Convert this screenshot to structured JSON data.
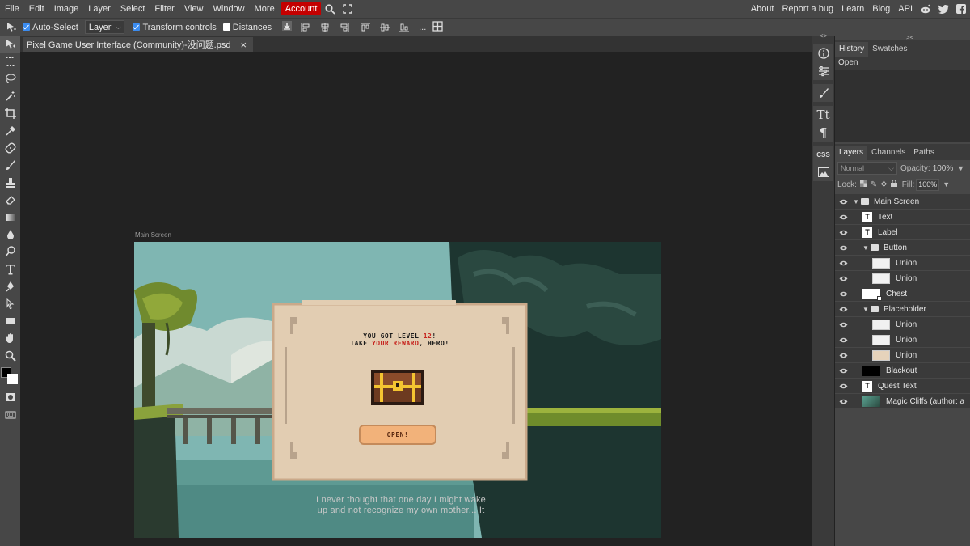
{
  "menu": {
    "items": [
      "File",
      "Edit",
      "Image",
      "Layer",
      "Select",
      "Filter",
      "View",
      "Window",
      "More"
    ],
    "account": "Account",
    "right_items": [
      "About",
      "Report a bug",
      "Learn",
      "Blog",
      "API"
    ]
  },
  "options": {
    "auto_select": "Auto-Select",
    "auto_select_checked": true,
    "target": "Layer",
    "transform_controls": "Transform controls",
    "transform_checked": true,
    "distances": "Distances",
    "distances_checked": false,
    "more": "..."
  },
  "document": {
    "tab_title": "Pixel Game User Interface (Community)-没问题.psd",
    "artboard_label": "Main Screen"
  },
  "artwork": {
    "dialog_line1_a": "YOU GOT LEVEL ",
    "dialog_line1_num": "12",
    "dialog_line1_b": "!",
    "dialog_line2_a": "TAKE ",
    "dialog_line2_red": "YOUR REWARD",
    "dialog_line2_b": ", HERO!",
    "button_label": "OPEN!",
    "quest_text_line1": "I never thought that one day I might wake",
    "quest_text_line2": "up and not recognize my own mother... It"
  },
  "right_panel": {
    "top_tabs": [
      "History",
      "Swatches"
    ],
    "history_items": [
      "Open"
    ],
    "layer_tabs": [
      "Layers",
      "Channels",
      "Paths"
    ],
    "blend_mode": "Normal",
    "opacity_label": "Opacity:",
    "opacity_value": "100%",
    "lock_label": "Lock:",
    "fill_label": "Fill:",
    "fill_value": "100%"
  },
  "layers": [
    {
      "name": "Main Screen",
      "kind": "folder",
      "indent": 0
    },
    {
      "name": "Text",
      "kind": "text",
      "indent": 1
    },
    {
      "name": "Label",
      "kind": "text",
      "indent": 1
    },
    {
      "name": "Button",
      "kind": "folder",
      "indent": 1
    },
    {
      "name": "Union",
      "kind": "shape",
      "indent": 2
    },
    {
      "name": "Union",
      "kind": "shape",
      "indent": 2
    },
    {
      "name": "Chest",
      "kind": "image",
      "indent": 1
    },
    {
      "name": "Placeholder",
      "kind": "folder",
      "indent": 1
    },
    {
      "name": "Union",
      "kind": "shape",
      "indent": 2
    },
    {
      "name": "Union",
      "kind": "shape",
      "indent": 2
    },
    {
      "name": "Union",
      "kind": "shape-tan",
      "indent": 2
    },
    {
      "name": "Blackout",
      "kind": "black",
      "indent": 1
    },
    {
      "name": "Quest Text",
      "kind": "text",
      "indent": 1
    },
    {
      "name": "Magic Cliffs (author: a",
      "kind": "image-green",
      "indent": 1
    }
  ],
  "colors": {
    "accent_red": "#c40000",
    "panel": "#474747",
    "canvas_bg": "#222222",
    "dialog_bg": "#e2cdb2",
    "button_fill": "#f2b27a"
  }
}
